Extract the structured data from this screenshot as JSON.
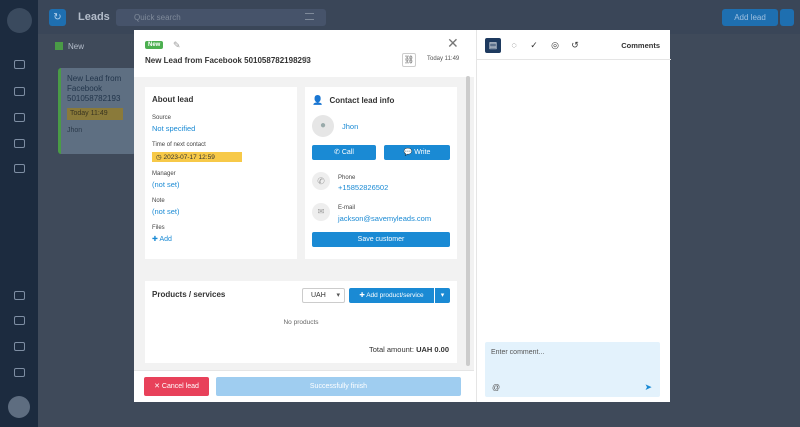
{
  "background": {
    "header_title": "Leads",
    "search_placeholder": "Quick search",
    "add_button": "Add lead",
    "column_name": "New",
    "card": {
      "title": "New Lead from Facebook 501058782193",
      "date": "Today 11:49",
      "user": "Jhon"
    }
  },
  "modal": {
    "status_badge": "New",
    "title": "New Lead from Facebook 501058782198293",
    "time": "Today 11:49",
    "about": {
      "heading": "About lead",
      "source_label": "Source",
      "source_value": "Not specified",
      "next_contact_label": "Time of next contact",
      "next_contact_value": "2023-07-17 12:59",
      "manager_label": "Manager",
      "manager_value": "(not set)",
      "note_label": "Note",
      "note_value": "(not set)",
      "files_label": "Files",
      "files_add": "Add"
    },
    "contact": {
      "heading": "Contact lead info",
      "name": "Jhon",
      "call_button": "Call",
      "write_button": "Write",
      "phone_label": "Phone",
      "phone_value": "+15852826502",
      "email_label": "E-mail",
      "email_value": "jackson@savemyleads.com",
      "save_button": "Save customer"
    },
    "products": {
      "heading": "Products / services",
      "currency": "UAH",
      "add_button": "Add product/service",
      "empty_text": "No products",
      "total_label": "Total amount:",
      "total_value": "UAH 0.00"
    },
    "footer": {
      "cancel_button": "Cancel lead",
      "finish_button": "Successfully finish"
    },
    "sidepanel": {
      "title": "Comments",
      "input_placeholder": "Enter comment...",
      "at_symbol": "@"
    }
  },
  "colors": {
    "accent": "#1a8ad4",
    "cancel": "#e8415a",
    "new_badge": "#4caf50",
    "date_highlight": "#f7c948",
    "active_tab": "#1e3a5f"
  }
}
